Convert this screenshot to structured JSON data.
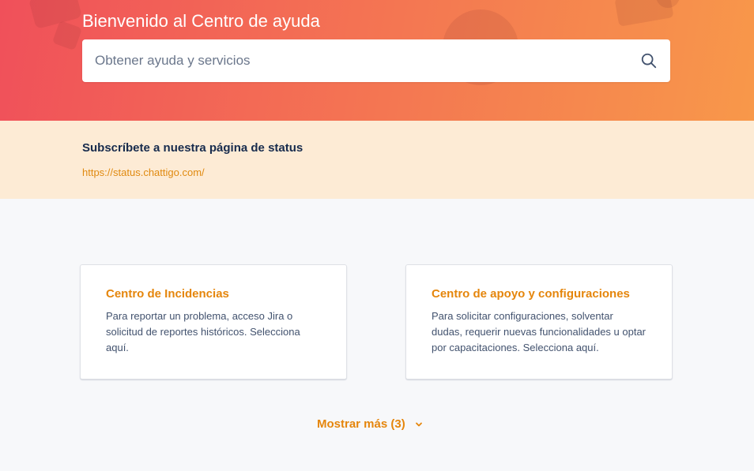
{
  "hero": {
    "title": "Bienvenido al Centro de ayuda",
    "search_placeholder": "Obtener ayuda y servicios",
    "search_icon": "search-icon",
    "gradient_colors": [
      "#f0505a",
      "#f8984a"
    ]
  },
  "status": {
    "title": "Subscríbete a nuestra página de status",
    "link": "https://status.chattigo.com/",
    "background": "#fdebd5"
  },
  "cards": [
    {
      "title": "Centro de Incidencias",
      "description": "Para reportar un problema, acceso Jira o solicitud de reportes históricos. Selecciona aquí."
    },
    {
      "title": "Centro de apoyo y configuraciones",
      "description": "Para solicitar configuraciones, solventar dudas, requerir nuevas funcionalidades u optar por capacitaciones. Selecciona aquí."
    }
  ],
  "show_more": {
    "label": "Mostrar más (3)",
    "icon": "chevron-down-icon"
  },
  "colors": {
    "accent": "#e5860c",
    "link": "#e08a10",
    "text_dark": "#172b4d",
    "text_body": "#42526e"
  }
}
